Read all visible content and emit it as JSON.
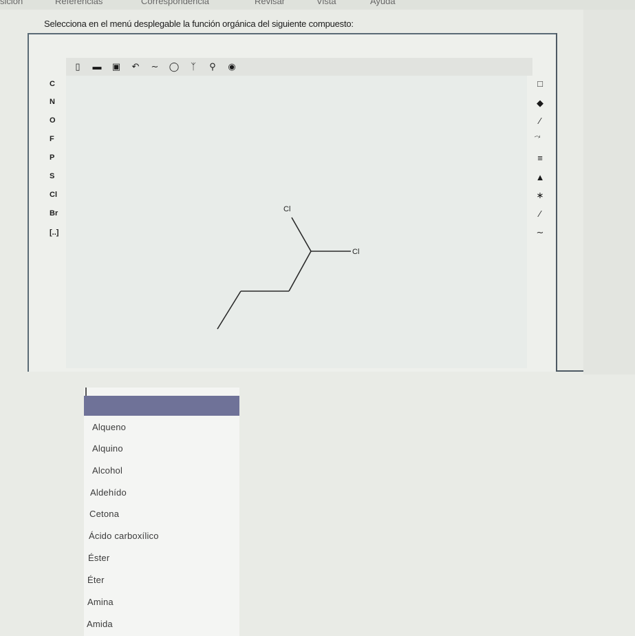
{
  "menubar": {
    "items": [
      "sición",
      "Referencias",
      "Correspondencia",
      "Revisar",
      "Vista",
      "Ayuda"
    ]
  },
  "question": {
    "text": "Selecciona en el menú desplegable la función orgánica del siguiente compuesto:"
  },
  "editor": {
    "toolbar_icons": [
      "new-file-icon",
      "open-folder-icon",
      "save-icon",
      "undo-icon",
      "redo-icon",
      "template-ring-icon",
      "structure-icon",
      "zoom-icon",
      "help-icon"
    ],
    "elements": [
      "C",
      "N",
      "O",
      "F",
      "P",
      "S",
      "Cl",
      "Br",
      "[..]"
    ],
    "right_tools": [
      "select-icon",
      "eraser-icon",
      "single-bond-icon",
      "double-bond-icon",
      "triple-bond-icon",
      "wedge-bond-icon",
      "stereo-bond-icon",
      "hash-bond-icon",
      "chain-icon"
    ],
    "atom_labels": [
      "Cl",
      "Cl"
    ]
  },
  "dropdown": {
    "selected": "",
    "options": [
      "Alqueno",
      "Alquino",
      "Alcohol",
      "Aldehído",
      "Cetona",
      "Ácido carboxílico",
      "Éster",
      "Éter",
      "Amina",
      "Amida"
    ]
  },
  "colors": {
    "dropdown_header": "#6f7298",
    "frame_border": "#5a6a75"
  }
}
